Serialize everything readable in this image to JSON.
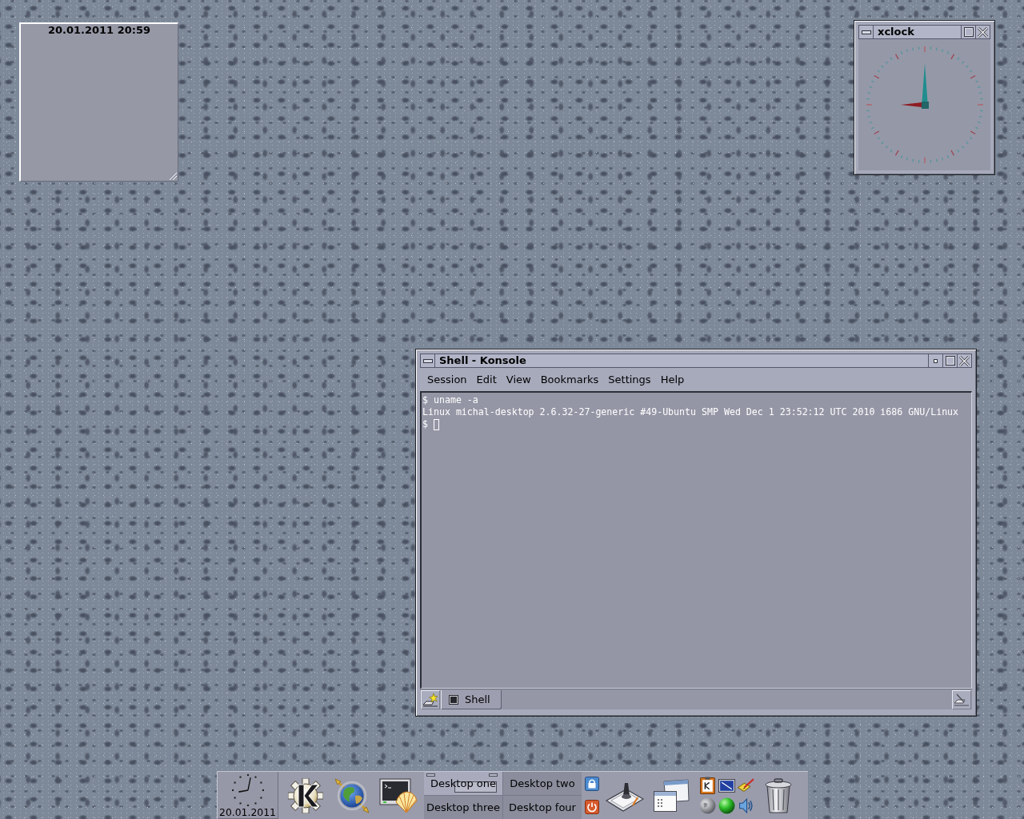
{
  "note": {
    "title": "20.01.2011 20:59"
  },
  "xclock": {
    "title": "xclock"
  },
  "konsole": {
    "title": "Shell - Konsole",
    "menu": [
      "Session",
      "Edit",
      "View",
      "Bookmarks",
      "Settings",
      "Help"
    ],
    "lines": [
      {
        "text": "$ uname -a",
        "cursor": false
      },
      {
        "text": "Linux michal-desktop 2.6.32-27-generic #49-Ubuntu SMP Wed Dec 1 23:52:12 UTC 2010 i686 GNU/Linux",
        "cursor": false
      },
      {
        "text": "$",
        "cursor": true
      }
    ],
    "tabs": [
      {
        "label": "Shell",
        "selected": true
      }
    ]
  },
  "taskbar": {
    "clock_date": "20.01.2011",
    "pager": [
      {
        "label": "Desktop one",
        "selected": true
      },
      {
        "label": "Desktop two",
        "selected": false
      },
      {
        "label": "Desktop three",
        "selected": false
      },
      {
        "label": "Desktop four",
        "selected": false
      }
    ]
  }
}
